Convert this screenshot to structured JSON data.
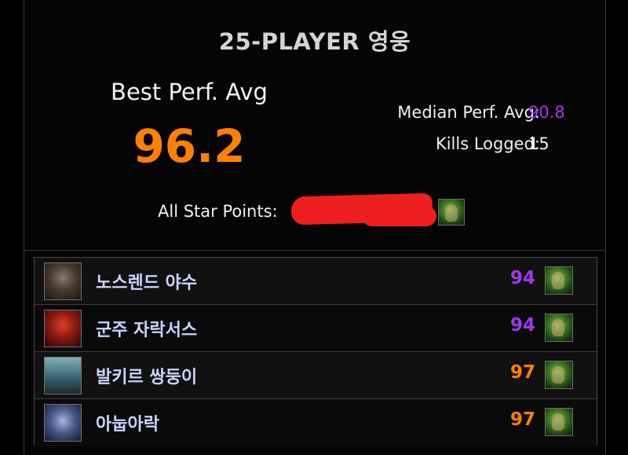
{
  "header": {
    "title": "25-PLAYER 영웅"
  },
  "summary": {
    "best_label": "Best Perf. Avg",
    "best_value": "96.2",
    "median_label": "Median Perf. Avg:",
    "median_value": "90.8",
    "kills_label": "Kills Logged:",
    "kills_value": "15",
    "star_label": "All Star Points:",
    "star_paren": "(",
    "star_icon": "spec-portrait-icon",
    "redaction_color": "#ef1f1f"
  },
  "colors": {
    "best": "#ff8000",
    "epic": "#a335ee",
    "legendary": "#ff8000"
  },
  "bosses": [
    {
      "name": "노스렌드 야수",
      "score": "94",
      "color": "#a335ee",
      "icon": "northrend-beasts-icon"
    },
    {
      "name": "군주 자락서스",
      "score": "94",
      "color": "#a335ee",
      "icon": "lord-jaraxxus-icon"
    },
    {
      "name": "발키르 쌍둥이",
      "score": "97",
      "color": "#ff8000",
      "icon": "valkyr-twins-icon"
    },
    {
      "name": "아눕아락",
      "score": "97",
      "color": "#ff8000",
      "icon": "anubarak-icon"
    }
  ]
}
